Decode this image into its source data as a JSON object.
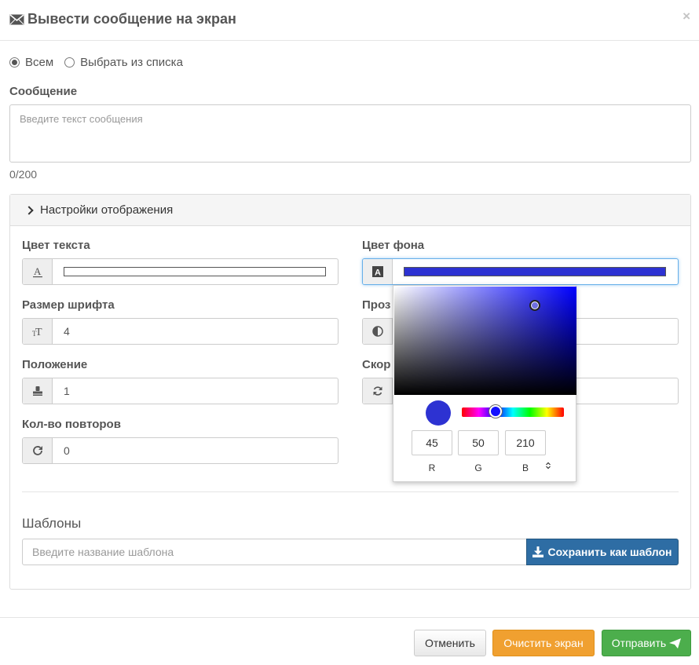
{
  "header": {
    "title": "Вывести сообщение на экран",
    "close": "×",
    "icon": "envelope-icon"
  },
  "recipients": {
    "options": [
      "Всем",
      "Выбрать из списка"
    ],
    "selected": "Всем"
  },
  "message": {
    "label": "Сообщение",
    "placeholder": "Введите текст сообщения",
    "value": "",
    "counter": "0/200"
  },
  "settings": {
    "title": "Настройки отображения",
    "text_color": {
      "label": "Цвет текста",
      "value": "#ffffff"
    },
    "bg_color": {
      "label": "Цвет фона",
      "value": "#2d32d2"
    },
    "font_size": {
      "label": "Размер шрифта",
      "value": "4"
    },
    "transparency": {
      "label": "Проз"
    },
    "position": {
      "label": "Положение",
      "value": "1"
    },
    "speed": {
      "label": "Скор"
    },
    "repeats": {
      "label": "Кол-во повторов",
      "value": "0"
    }
  },
  "templates": {
    "title": "Шаблоны",
    "placeholder": "Введите название шаблона",
    "save_label": "Сохранить как шаблон"
  },
  "color_picker": {
    "r": "45",
    "g": "50",
    "b": "210",
    "r_label": "R",
    "g_label": "G",
    "b_label": "B",
    "toggle": "⌃⌄",
    "color": "#2d32d2"
  },
  "footer": {
    "cancel": "Отменить",
    "clear": "Очистить экран",
    "send": "Отправить"
  }
}
